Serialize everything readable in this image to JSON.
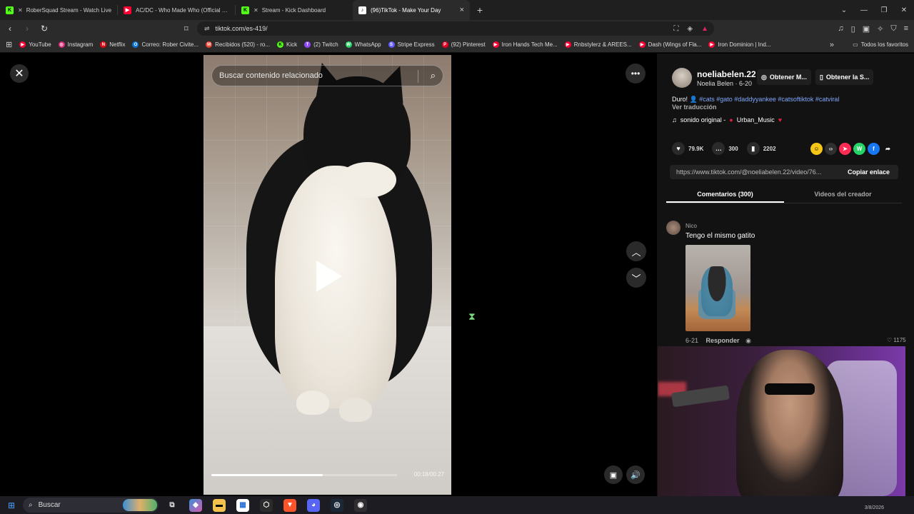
{
  "browser": {
    "tabs": [
      {
        "title": "RoberSquad Stream - Watch Live",
        "icon": "kick-icon",
        "color": "#53fc18",
        "active": false,
        "muted": true
      },
      {
        "title": "AC/DC - Who Made Who (Official HD",
        "icon": "youtube-icon",
        "color": "#ff0033",
        "active": false,
        "muted": false
      },
      {
        "title": "Stream - Kick Dashboard",
        "icon": "kick-icon",
        "color": "#53fc18",
        "active": false,
        "muted": true
      },
      {
        "title": "(96)TikTok - Make Your Day",
        "icon": "tiktok-icon",
        "color": "#ffffff",
        "active": true,
        "muted": false
      }
    ],
    "url": "tiktok.com/es-419/",
    "bookmarks": [
      {
        "label": "YouTube",
        "color": "#ff0033"
      },
      {
        "label": "Instagram",
        "color": "#d62976"
      },
      {
        "label": "Netflix",
        "color": "#e50914"
      },
      {
        "label": "Correo: Rober Civite...",
        "color": "#0a74da"
      },
      {
        "label": "Recibidos (520) - ro...",
        "color": "#ea4335"
      },
      {
        "label": "Kick",
        "color": "#53fc18"
      },
      {
        "label": "(2) Twitch",
        "color": "#9146ff"
      },
      {
        "label": "WhatsApp",
        "color": "#25d366"
      },
      {
        "label": "Stripe Express",
        "color": "#635bff"
      },
      {
        "label": "(92) Pinterest",
        "color": "#e60023"
      },
      {
        "label": "Iron Hands Tech Me...",
        "color": "#ff0033"
      },
      {
        "label": "Rnbstylerz & AREES...",
        "color": "#ff0033"
      },
      {
        "label": "Dash (Wings of Fla...",
        "color": "#ff0033"
      },
      {
        "label": "Iron Dominion | Ind...",
        "color": "#ff0033"
      }
    ],
    "all_bookmarks": "Todos los favoritos"
  },
  "video": {
    "search_placeholder": "Buscar contenido relacionado",
    "progress": 0.6,
    "timecode": "00:18/00:27"
  },
  "post": {
    "handle": "noeliabelen.22",
    "name_date": "Noelia Belen · 6-20",
    "overlay_btn_1": "Obtener M...",
    "overlay_btn_2": "Obtener la S...",
    "desc_prefix": "Duro!",
    "tags": "#cats #gato #daddyyankee #catsoftiktok #catviral",
    "translate": "Ver traducción",
    "music": "sonido original - ",
    "music_artist": "Urban_Music",
    "likes": "79.9K",
    "comments": "300",
    "saves": "2202",
    "link": "https://www.tiktok.com/@noeliabelen.22/video/76...",
    "copy_link": "Copiar enlace",
    "tab_comments": "Comentarios (300)",
    "tab_creator": "Videos del creador"
  },
  "comment": {
    "user": "Nico",
    "text": "Tengo el mismo gatito",
    "date": "6-21",
    "reply": "Responder",
    "likes": "1175"
  },
  "taskbar": {
    "search": "Buscar",
    "date": "3/8/2026"
  }
}
